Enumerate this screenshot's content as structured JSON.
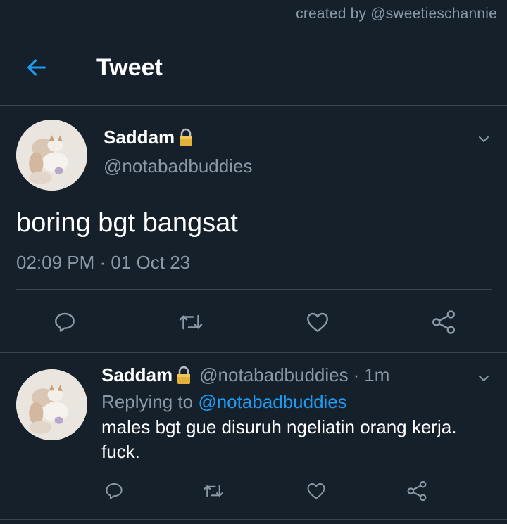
{
  "credit": "created by @sweetieschannie",
  "header": {
    "title": "Tweet",
    "back_icon": "arrow-left-icon"
  },
  "tweet": {
    "display_name": "Saddam",
    "handle": "@notabadbuddies",
    "text": "boring bgt bangsat",
    "timestamp": "02:09 PM · 01 Oct 23",
    "protected_icon": "lock-icon",
    "menu_icon": "chevron-down-icon"
  },
  "reply": {
    "display_name": "Saddam",
    "handle": "@notabadbuddies",
    "time": "1m",
    "separator": "·",
    "replying_prefix": "Replying to",
    "replying_to": "@notabadbuddies",
    "text": "males bgt gue disuruh ngeliatin orang kerja. fuck."
  },
  "actions": [
    "reply-icon",
    "retweet-icon",
    "like-icon",
    "share-icon"
  ],
  "colors": {
    "background": "#15202b",
    "accent": "#1d9bf0",
    "secondary_text": "#8b98a5",
    "divider": "#38444d"
  }
}
